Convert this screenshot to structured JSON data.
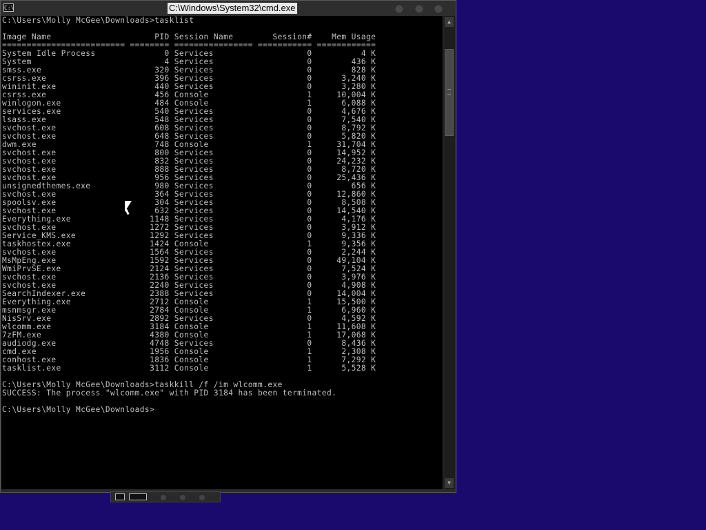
{
  "window": {
    "title": "C:\\Windows\\System32\\cmd.exe",
    "icon_label": "C:\\",
    "icon": "cmd-icon"
  },
  "console": {
    "lines": [
      "C:\\Users\\Molly McGee\\Downloads>tasklist",
      "",
      "Image Name                     PID Session Name        Session#    Mem Usage",
      "========================= ======== ================ =========== ============",
      "System Idle Process              0 Services                   0          4 K",
      "System                           4 Services                   0        436 K",
      "smss.exe                       320 Services                   0        828 K",
      "csrss.exe                      396 Services                   0      3,240 K",
      "wininit.exe                    440 Services                   0      3,280 K",
      "csrss.exe                      456 Console                    1     10,004 K",
      "winlogon.exe                   484 Console                    1      6,088 K",
      "services.exe                   540 Services                   0      4,676 K",
      "lsass.exe                      548 Services                   0      7,540 K",
      "svchost.exe                    608 Services                   0      8,792 K",
      "svchost.exe                    648 Services                   0      5,820 K",
      "dwm.exe                        748 Console                    1     31,704 K",
      "svchost.exe                    800 Services                   0     14,952 K",
      "svchost.exe                    832 Services                   0     24,232 K",
      "svchost.exe                    888 Services                   0      8,720 K",
      "svchost.exe                    956 Services                   0     25,436 K",
      "unsignedthemes.exe             980 Services                   0        656 K",
      "svchost.exe                    364 Services                   0     12,860 K",
      "spoolsv.exe                    304 Services                   0      8,508 K",
      "svchost.exe                    632 Services                   0     14,540 K",
      "Everything.exe                1148 Services                   0      4,176 K",
      "svchost.exe                   1272 Services                   0      3,912 K",
      "Service_KMS.exe               1292 Services                   0      9,336 K",
      "taskhostex.exe                1424 Console                    1      9,356 K",
      "svchost.exe                   1564 Services                   0      2,244 K",
      "MsMpEng.exe                   1592 Services                   0     49,104 K",
      "WmiPrvSE.exe                  2124 Services                   0      7,524 K",
      "svchost.exe                   2136 Services                   0      3,976 K",
      "svchost.exe                   2240 Services                   0      4,908 K",
      "SearchIndexer.exe             2388 Services                   0     14,004 K",
      "Everything.exe                2712 Console                    1     15,500 K",
      "msnmsgr.exe                   2784 Console                    1      6,960 K",
      "NisSrv.exe                    2892 Services                   0      4,592 K",
      "wlcomm.exe                    3184 Console                    1     11,608 K",
      "7zFM.exe                      4380 Console                    1     17,068 K",
      "audiodg.exe                   4748 Services                   0      8,436 K",
      "cmd.exe                       1956 Console                    1      2,308 K",
      "conhost.exe                   1836 Console                    1      7,292 K",
      "tasklist.exe                  3112 Console                    1      5,528 K",
      "",
      "C:\\Users\\Molly McGee\\Downloads>taskkill /f /im wlcomm.exe",
      "SUCCESS: The process \"wlcomm.exe\" with PID 3184 has been terminated.",
      "",
      "C:\\Users\\Molly McGee\\Downloads>"
    ]
  },
  "scrollbar": {
    "up_icon": "scroll-up-arrow-icon",
    "down_icon": "scroll-down-arrow-icon"
  },
  "colors": {
    "desktop": "#1a0a6e",
    "console_bg": "#000000",
    "console_text": "#c0c0c0"
  }
}
